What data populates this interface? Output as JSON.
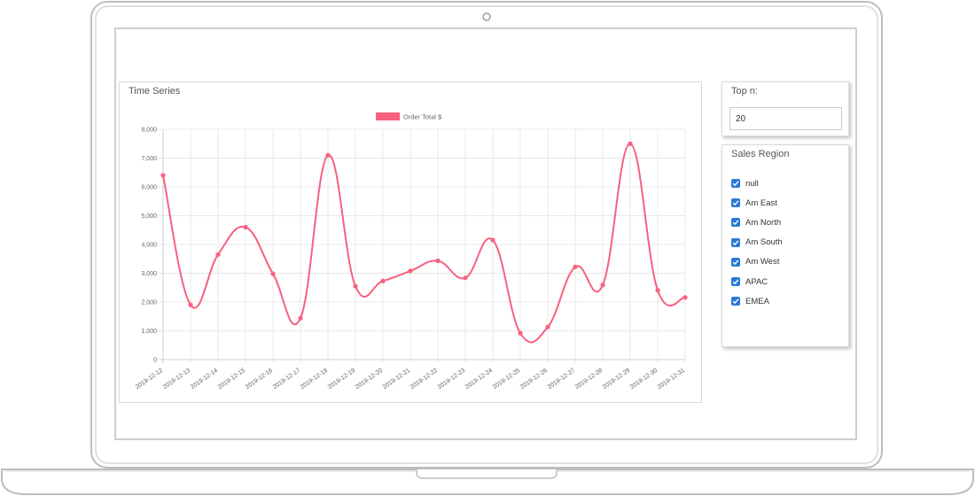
{
  "timeseries": {
    "title": "Time Series"
  },
  "topn": {
    "label": "Top n:",
    "value": "20"
  },
  "region": {
    "title": "Sales Region",
    "items": [
      {
        "label": "null",
        "checked": true
      },
      {
        "label": "Am East",
        "checked": true
      },
      {
        "label": "Am North",
        "checked": true
      },
      {
        "label": "Am South",
        "checked": true
      },
      {
        "label": "Am West",
        "checked": true
      },
      {
        "label": "APAC",
        "checked": true
      },
      {
        "label": "EMEA",
        "checked": true
      }
    ]
  },
  "colors": {
    "series": "#f7617f",
    "checkbox": "#2a7ad6"
  },
  "chart_data": {
    "type": "line",
    "title": "",
    "xlabel": "",
    "ylabel": "",
    "ylim": [
      0,
      8000
    ],
    "yticks": [
      0,
      1000,
      2000,
      3000,
      4000,
      5000,
      6000,
      7000,
      8000
    ],
    "ytick_labels": [
      "0",
      "1,000",
      "2,000",
      "3,000",
      "4,000",
      "5,000",
      "6,000",
      "7,000",
      "8,000"
    ],
    "legend_position": "top-center",
    "grid": true,
    "x": [
      "2019-12-12",
      "2019-12-13",
      "2019-12-14",
      "2019-12-15",
      "2019-12-16",
      "2019-12-17",
      "2019-12-18",
      "2019-12-19",
      "2019-12-20",
      "2019-12-21",
      "2019-12-22",
      "2019-12-23",
      "2019-12-24",
      "2019-12-25",
      "2019-12-26",
      "2019-12-27",
      "2019-12-28",
      "2019-12-29",
      "2019-12-30",
      "2019-12-31"
    ],
    "series": [
      {
        "name": "Order Total $",
        "color": "#f7617f",
        "values": [
          6400,
          1900,
          3650,
          4600,
          2980,
          1440,
          7100,
          2550,
          2730,
          3080,
          3430,
          2840,
          4150,
          920,
          1130,
          3220,
          2590,
          7500,
          2410,
          2160
        ]
      }
    ]
  }
}
